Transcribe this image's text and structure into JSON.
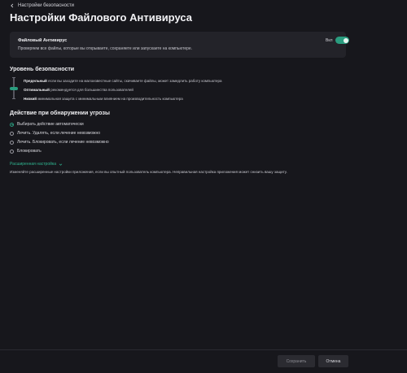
{
  "back_label": "Настройки безопасности",
  "page_title": "Настройки Файлового Антивируса",
  "card": {
    "title": "Файловый Антивирус",
    "description": "Проверяем все файлы, которые вы открываете, сохраняете или запускаете на компьютере.",
    "toggle_label": "Вкл",
    "toggle_on": true,
    "accent_color": "#2a9d7f"
  },
  "security_level": {
    "heading": "Уровень безопасности",
    "levels": [
      {
        "name": "Предельный",
        "desc": "если вы заходите на малоизвестные сайты, скачиваете файлы, может замедлить работу компьютера"
      },
      {
        "name": "Оптимальный",
        "desc": "рекомендуется для большинства пользователей"
      },
      {
        "name": "Низкий",
        "desc": "минимальная защита с минимальным влиянием на производительность компьютера"
      }
    ],
    "selected": "Оптимальный"
  },
  "threat_action": {
    "heading": "Действие при обнаружении угрозы",
    "options": [
      {
        "label": "Выбирать действие автоматически",
        "selected": true
      },
      {
        "label": "Лечить. Удалять, если лечение невозможно",
        "selected": false
      },
      {
        "label": "Лечить. Блокировать, если лечение невозможно",
        "selected": false
      },
      {
        "label": "Блокировать",
        "selected": false
      }
    ]
  },
  "advanced": {
    "link_label": "Расширенная настройка",
    "description": "Изменяйте расширенные настройки приложения, если вы опытный пользователь компьютера. Неправильная настройка приложения может снизить вашу защиту."
  },
  "footer": {
    "save_label": "Сохранить",
    "cancel_label": "Отмена"
  }
}
